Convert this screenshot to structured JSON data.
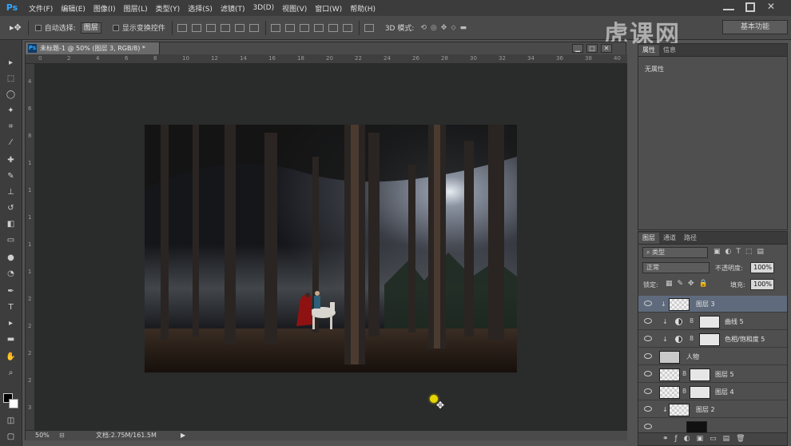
{
  "app": {
    "logo": "Ps"
  },
  "menu": [
    "文件(F)",
    "编辑(E)",
    "图像(I)",
    "图层(L)",
    "类型(Y)",
    "选择(S)",
    "滤镜(T)",
    "3D(D)",
    "视图(V)",
    "窗口(W)",
    "帮助(H)"
  ],
  "options": {
    "auto_select_label": "自动选择:",
    "auto_select_value": "图层",
    "show_transform_label": "显示变换控件",
    "mode_3d_label": "3D 模式:",
    "workspace_label": "基本功能"
  },
  "document": {
    "tab_title": "未标题-1 @ 50% (图层 3, RGB/8) *",
    "ruler_top": [
      "0",
      "2",
      "4",
      "6",
      "8",
      "10",
      "12",
      "14",
      "16",
      "18",
      "20",
      "22",
      "24",
      "26",
      "28",
      "30",
      "32",
      "34",
      "36",
      "38",
      "40"
    ],
    "ruler_left": [
      "4",
      "6",
      "8",
      "1",
      "1",
      "1",
      "1",
      "1",
      "2",
      "2",
      "2",
      "2",
      "3"
    ],
    "zoom": "50%",
    "doc_size": "文档:2.75M/161.5M"
  },
  "properties": {
    "tabs": [
      "属性",
      "信息"
    ],
    "content": "无属性"
  },
  "layers": {
    "tabs": [
      "图层",
      "通道",
      "路径"
    ],
    "filter_label": "类型",
    "blend_mode": "正常",
    "opacity_label": "不透明度:",
    "opacity_value": "100%",
    "lock_label": "锁定:",
    "fill_label": "填充:",
    "fill_value": "100%",
    "items": [
      {
        "name": "图层 3"
      },
      {
        "name": "曲线 5"
      },
      {
        "name": "色相/饱和度 5"
      },
      {
        "name": "人物"
      },
      {
        "name": "图层 5"
      },
      {
        "name": "图层 4"
      },
      {
        "name": "图层 2"
      }
    ]
  },
  "watermark": "虎课网"
}
